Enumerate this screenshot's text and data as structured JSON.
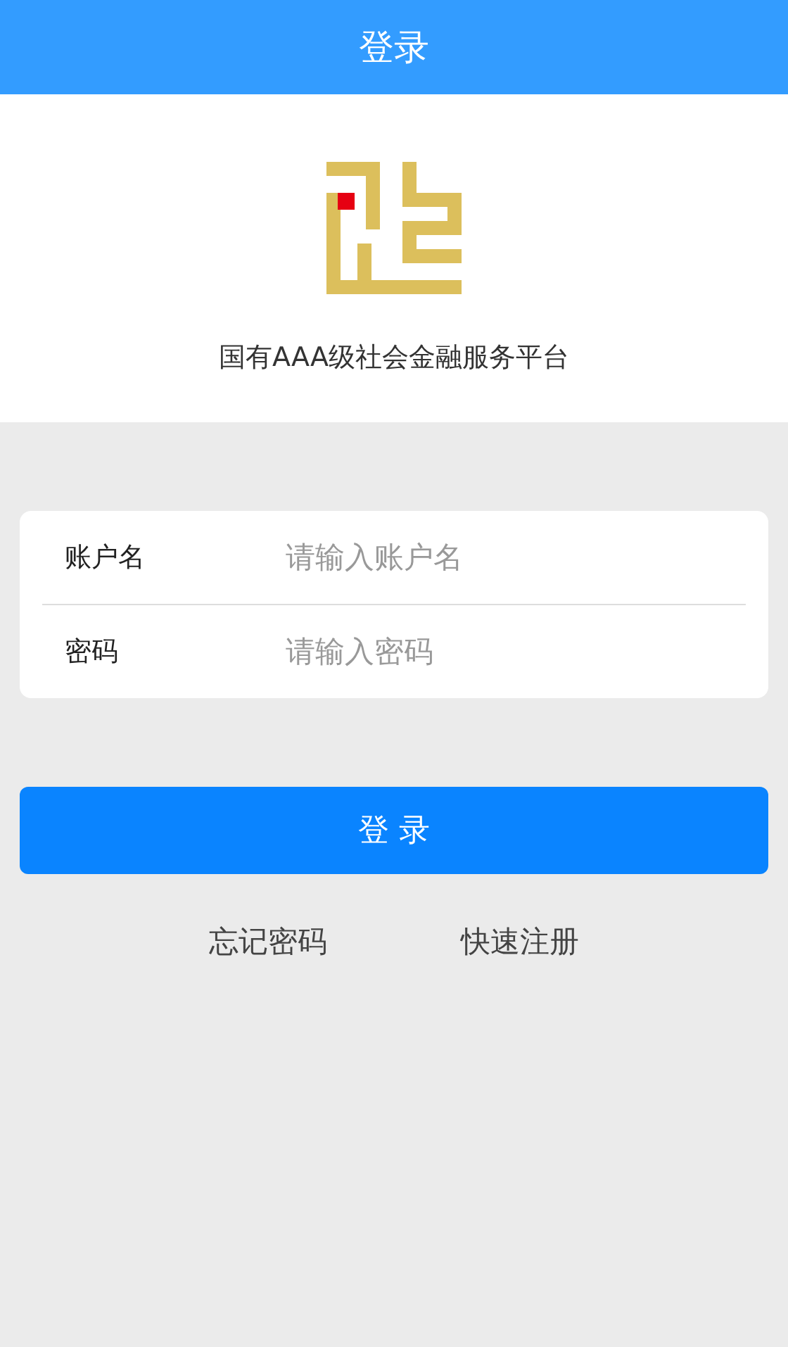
{
  "header": {
    "title": "登录"
  },
  "brand": {
    "tagline": "国有AAA级社会金融服务平台"
  },
  "form": {
    "fields": [
      {
        "label": "账户名",
        "placeholder": "请输入账户名"
      },
      {
        "label": "密码",
        "placeholder": "请输入密码"
      }
    ]
  },
  "login_button": "登 录",
  "links": [
    "忘记密码",
    "快速注册"
  ]
}
